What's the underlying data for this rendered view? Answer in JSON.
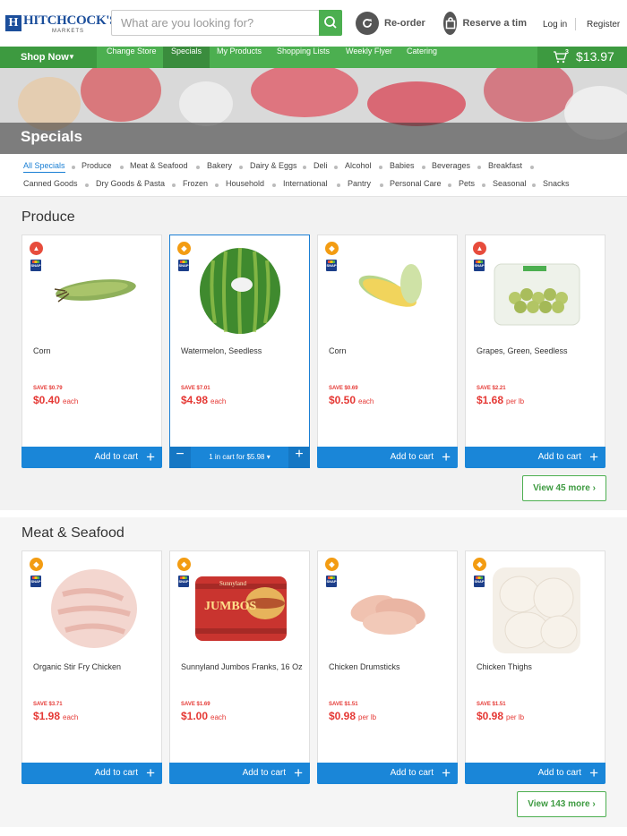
{
  "header": {
    "logo_name": "HITCHCOCK'S",
    "logo_sub": "MARKETS",
    "search_placeholder": "What are you looking for?",
    "reorder_label": "Re-order",
    "reserve_label": "Reserve a tim",
    "login_label": "Log in",
    "register_label": "Register"
  },
  "nav": {
    "shop_now": "Shop Now",
    "items": [
      "Change Store",
      "Specials",
      "My Products",
      "Shopping Lists",
      "Weekly Flyer",
      "Catering"
    ],
    "active": "Specials",
    "cart_count": "3",
    "cart_total": "$13.97"
  },
  "hero": {
    "title": "Specials"
  },
  "categories": {
    "row1": [
      "All Specials",
      "Produce",
      "Meat & Seafood",
      "Bakery",
      "Dairy & Eggs",
      "Deli",
      "Alcohol",
      "Babies",
      "Beverages",
      "Breakfast"
    ],
    "row2": [
      "Canned Goods",
      "Dry Goods & Pasta",
      "Frozen",
      "Household",
      "International",
      "Pantry",
      "Personal Care",
      "Pets",
      "Seasonal",
      "Snacks"
    ]
  },
  "sections": [
    {
      "title": "Produce",
      "view_more": "View 45 more",
      "products": [
        {
          "name": "Corn",
          "save": "SAVE $0.79",
          "price": "$0.40",
          "unit": "each",
          "badge": "flame-icon",
          "button": "Add to cart"
        },
        {
          "name": "Watermelon, Seedless",
          "save": "SAVE $7.01",
          "price": "$4.98",
          "unit": "each",
          "badge": "tag-icon",
          "qty_label": "1 in cart for $5.98",
          "qty_arrow": "▾"
        },
        {
          "name": "Corn",
          "save": "SAVE $0.69",
          "price": "$0.50",
          "unit": "each",
          "badge": "tag-icon",
          "button": "Add to cart"
        },
        {
          "name": "Grapes, Green, Seedless",
          "save": "SAVE $2.21",
          "price": "$1.68",
          "unit": "per lb",
          "badge": "flame-icon",
          "button": "Add to cart"
        }
      ]
    },
    {
      "title": "Meat & Seafood",
      "view_more": "View 143 more",
      "products": [
        {
          "name": "Organic Stir Fry Chicken",
          "save": "SAVE $3.71",
          "price": "$1.98",
          "unit": "each",
          "badge": "tag-icon",
          "button": "Add to cart"
        },
        {
          "name": "Sunnyland Jumbos Franks, 16 Oz",
          "save": "SAVE $1.69",
          "price": "$1.00",
          "unit": "each",
          "badge": "tag-icon",
          "button": "Add to cart",
          "package_text": "JUMBOS",
          "package_brand": "Sunnyland"
        },
        {
          "name": "Chicken Drumsticks",
          "save": "SAVE $1.51",
          "price": "$0.98",
          "unit": "per lb",
          "badge": "tag-icon",
          "button": "Add to cart"
        },
        {
          "name": "Chicken Thighs",
          "save": "SAVE $1.51",
          "price": "$0.98",
          "unit": "per lb",
          "badge": "tag-icon",
          "button": "Add to cart"
        }
      ]
    }
  ],
  "colors": {
    "brand_green": "#4caf50",
    "button_blue": "#1a86d8",
    "sale_red": "#e53935",
    "logo_blue": "#1b4e9b"
  }
}
